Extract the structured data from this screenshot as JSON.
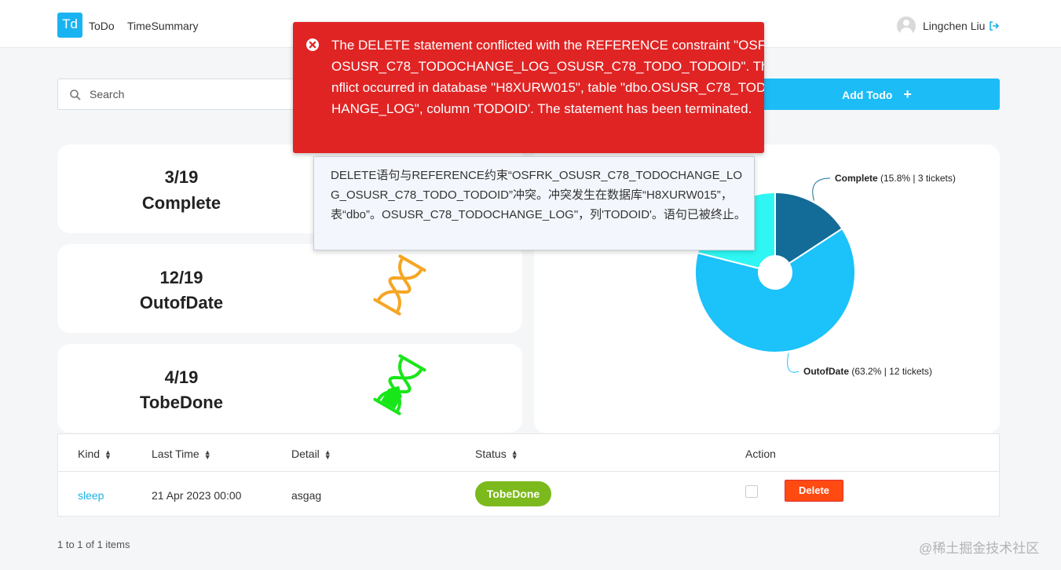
{
  "header": {
    "logo_text": "Td",
    "nav": [
      "ToDo",
      "TimeSummary"
    ],
    "user_name": "Lingchen Liu",
    "logout_icon": "logout-icon"
  },
  "search": {
    "placeholder": "Search",
    "value": ""
  },
  "add_button": {
    "label": "Add Todo",
    "icon": "+"
  },
  "stats": [
    {
      "count": "3/19",
      "label": "Complete"
    },
    {
      "count": "12/19",
      "label": "OutofDate",
      "icon": "hourglass-icon",
      "color": "#f5a623"
    },
    {
      "count": "4/19",
      "label": "TobeDone",
      "icon": "hourglass-icon",
      "color": "#19e619"
    }
  ],
  "chart_data": {
    "type": "pie",
    "style": "donut",
    "categories": [
      "Complete",
      "OutofDate",
      "TobeDone"
    ],
    "values": [
      3,
      12,
      4
    ],
    "colors": [
      "#136b97",
      "#1cc2fa",
      "#2ff6f2"
    ],
    "annotations": [
      {
        "name": "Complete",
        "detail": "(15.8% | 3 tickets)"
      },
      {
        "name": "OutofDate",
        "detail": "(63.2% | 12 tickets)"
      }
    ],
    "legend": "none"
  },
  "table": {
    "columns": [
      {
        "label": "Kind",
        "sortable": true
      },
      {
        "label": "Last Time",
        "sortable": true
      },
      {
        "label": "Detail",
        "sortable": true
      },
      {
        "label": "Status",
        "sortable": true
      },
      {
        "label": "Action",
        "sortable": false
      }
    ],
    "rows": [
      {
        "kind": "sleep",
        "last_time": "21 Apr 2023 00:00",
        "detail": "asgag",
        "status": "TobeDone",
        "action_label": "Delete"
      }
    ],
    "status_color": "#7cb91c",
    "delete_color": "#ff4a12"
  },
  "pager": {
    "text": "1 to 1 of 1 items"
  },
  "watermark": "@稀土掘金技术社区",
  "error_toast": {
    "message": "The DELETE statement conflicted with the REFERENCE constraint \"OSFRK_OSUSR_C78_TODOCHANGE_LOG_OSUSR_C78_TODO_TODOID\". The conflict occurred in database \"H8XURW015\", table \"dbo.OSUSR_C78_TODOCHANGE_LOG\", column 'TODOID'. The statement has been terminated.",
    "color": "#e02424"
  },
  "tooltip": {
    "text": "DELETE语句与REFERENCE约束“OSFRK_OSUSR_C78_TODOCHANGE_LOG_OSUSR_C78_TODO_TODOID”冲突。冲突发生在数据库“H8XURW015”，表“dbo”。OSUSR_C78_TODOCHANGE_LOG\"，列'TODOID'。语句已被终止。"
  }
}
